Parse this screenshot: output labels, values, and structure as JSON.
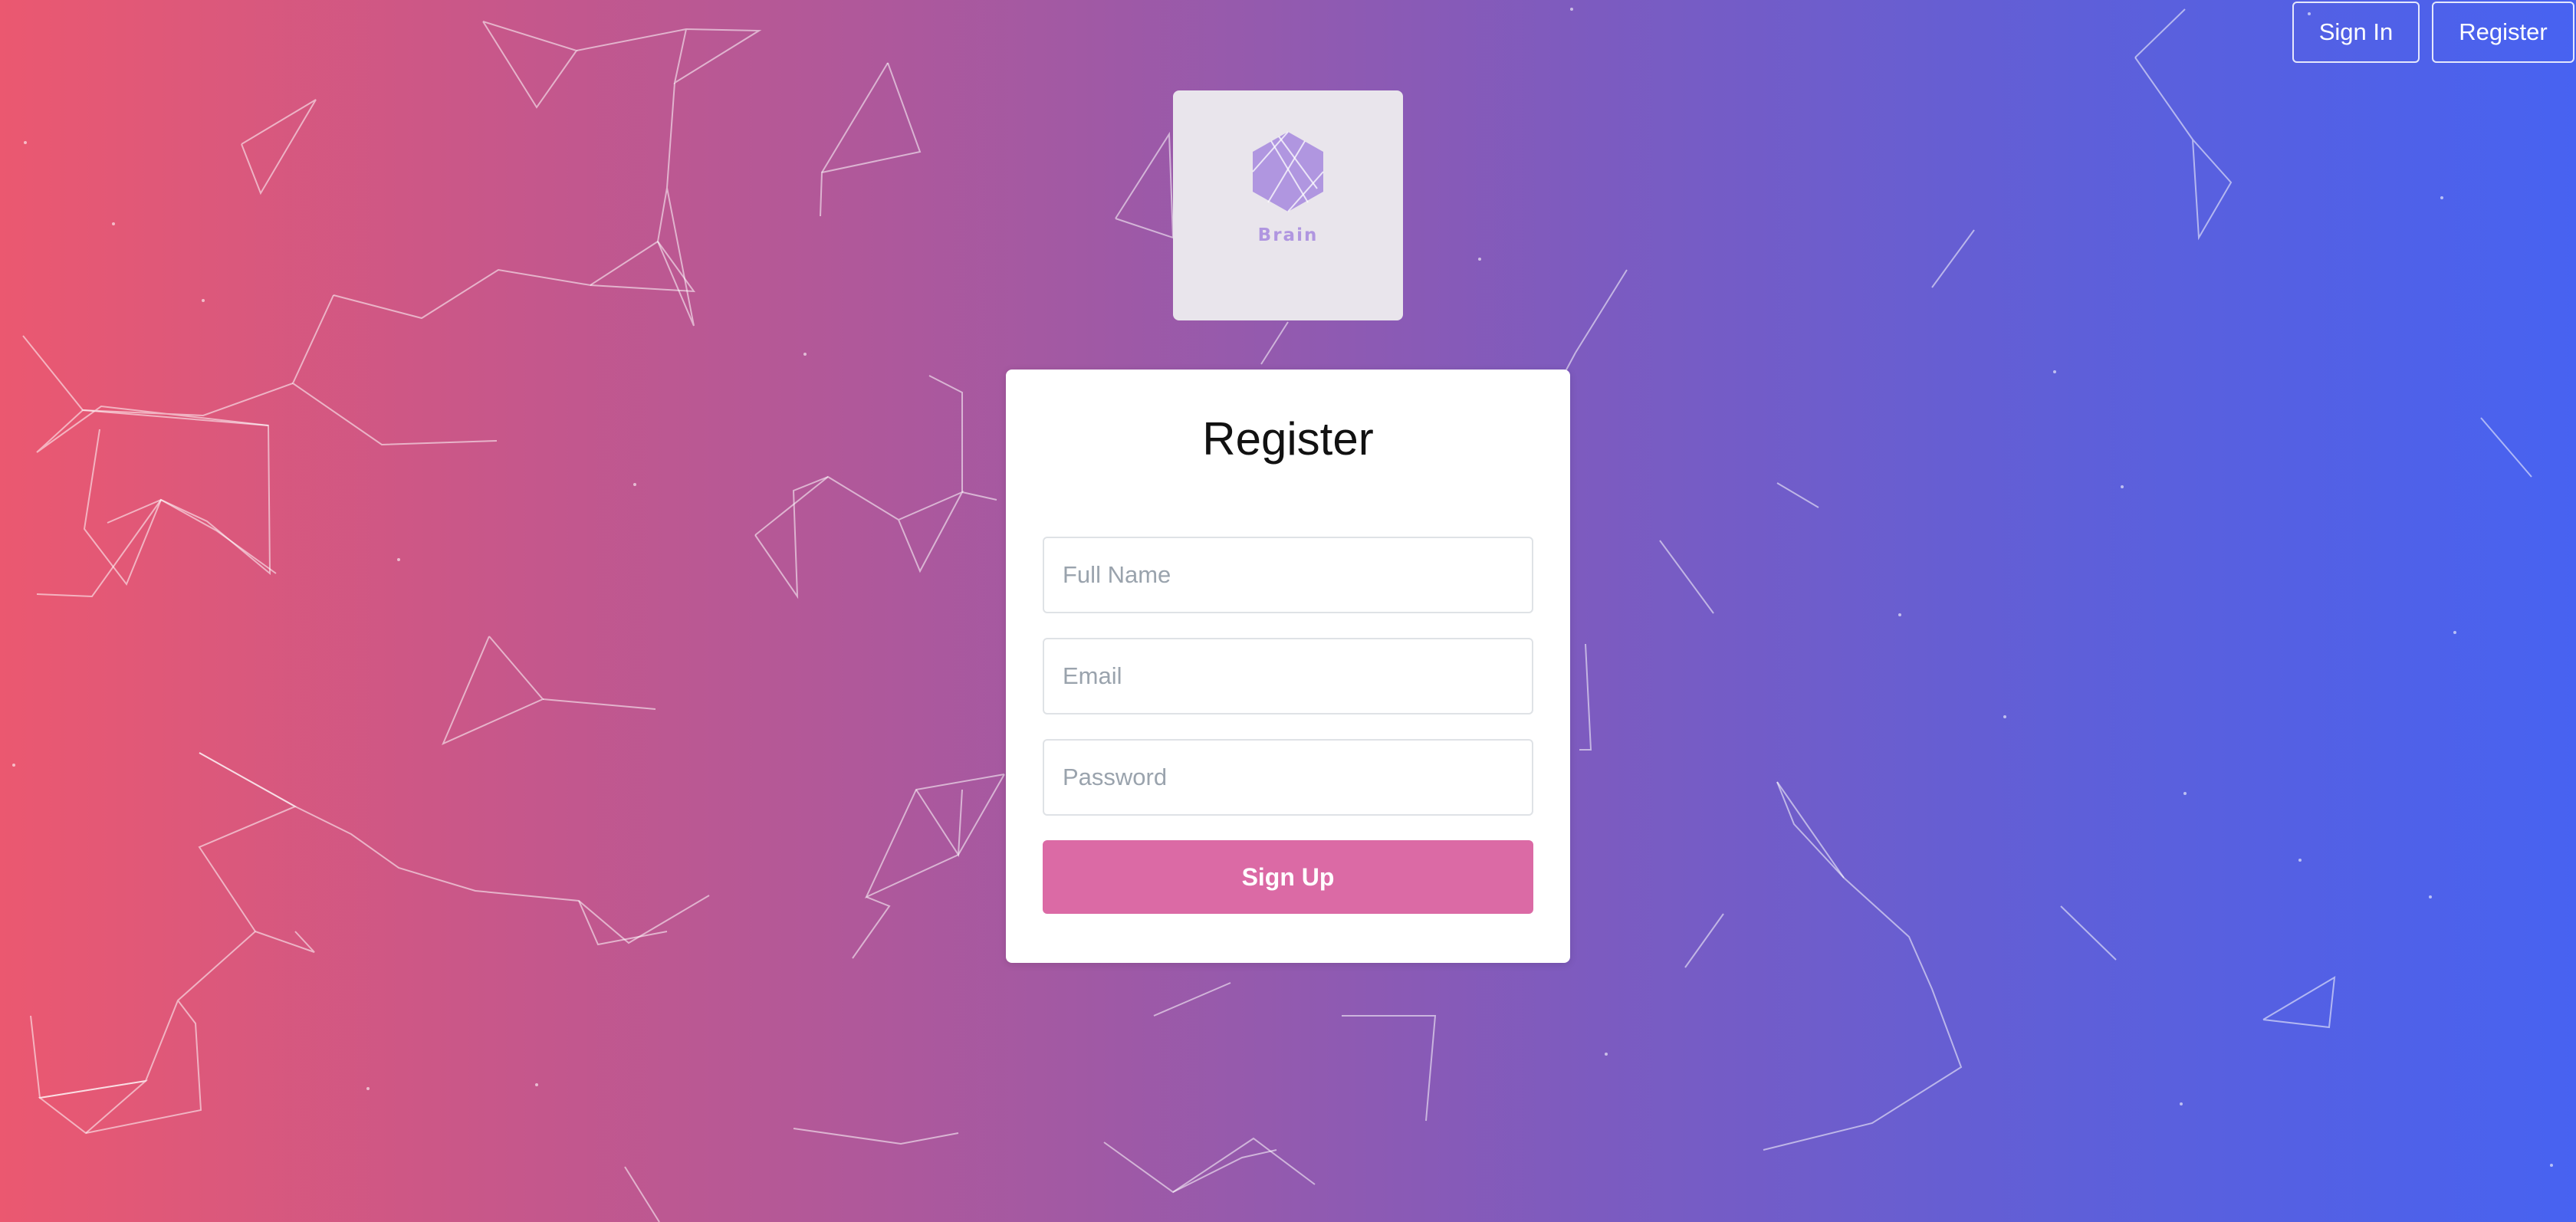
{
  "nav": {
    "signin_label": "Sign In",
    "register_label": "Register"
  },
  "logo": {
    "text": "Brain",
    "icon": "hexagon-brain-logo"
  },
  "form": {
    "title": "Register",
    "full_name_placeholder": "Full Name",
    "email_placeholder": "Email",
    "password_placeholder": "Password",
    "submit_label": "Sign Up"
  },
  "colors": {
    "gradient_start": "#eb5870",
    "gradient_end": "#4762f1",
    "button": "#db6aa5",
    "logo_accent": "#b096e0"
  }
}
